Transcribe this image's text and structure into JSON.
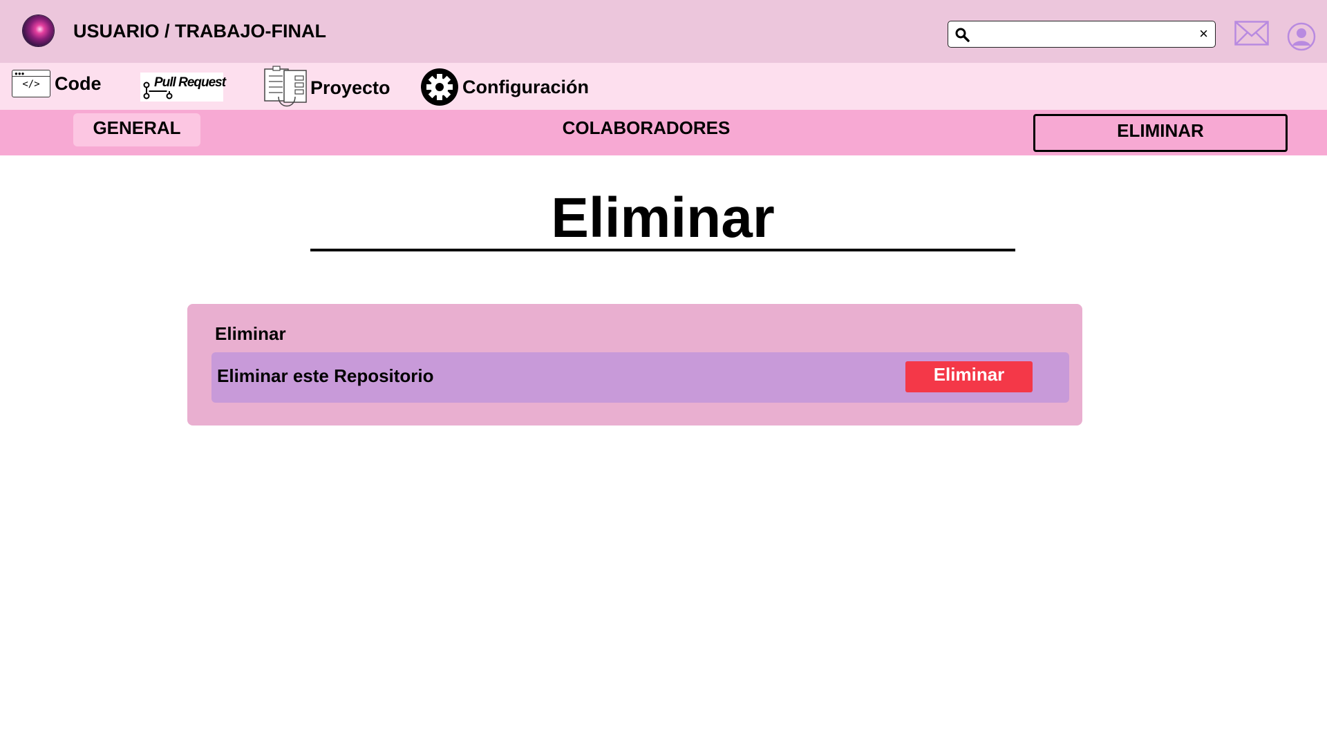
{
  "header": {
    "user": "USUARIO /",
    "repo": "TRABAJO-FINAL",
    "search": {
      "value": "",
      "placeholder": "",
      "clear_symbol": "×"
    }
  },
  "repo_nav": {
    "code_label": "Code",
    "code_icon_text": "</>",
    "pull_request_label": "Pull Request",
    "project_label": "Proyecto",
    "config_label": "Configuración"
  },
  "tabs": [
    {
      "label": "GENERAL"
    },
    {
      "label": "COLABORADORES"
    },
    {
      "label": "ELIMINAR"
    }
  ],
  "main": {
    "title": "Eliminar",
    "panel": {
      "heading": "Eliminar",
      "row_label": "Eliminar este Repositorio",
      "button_label": "Eliminar"
    }
  },
  "colors": {
    "header_bg": "#ecc6dc",
    "nav_bg": "#fddfee",
    "tabs_bg": "#f7a9d3",
    "panel_bg": "#e9afd0",
    "row_bg": "#c89ad9",
    "danger_button": "#f43848",
    "icon_accent": "#b88ae0"
  },
  "icons": [
    "galaxy-logo",
    "search-icon",
    "close-icon",
    "mail-icon",
    "user-icon",
    "code-icon",
    "pull-request-icon",
    "project-icon",
    "gear-icon"
  ]
}
